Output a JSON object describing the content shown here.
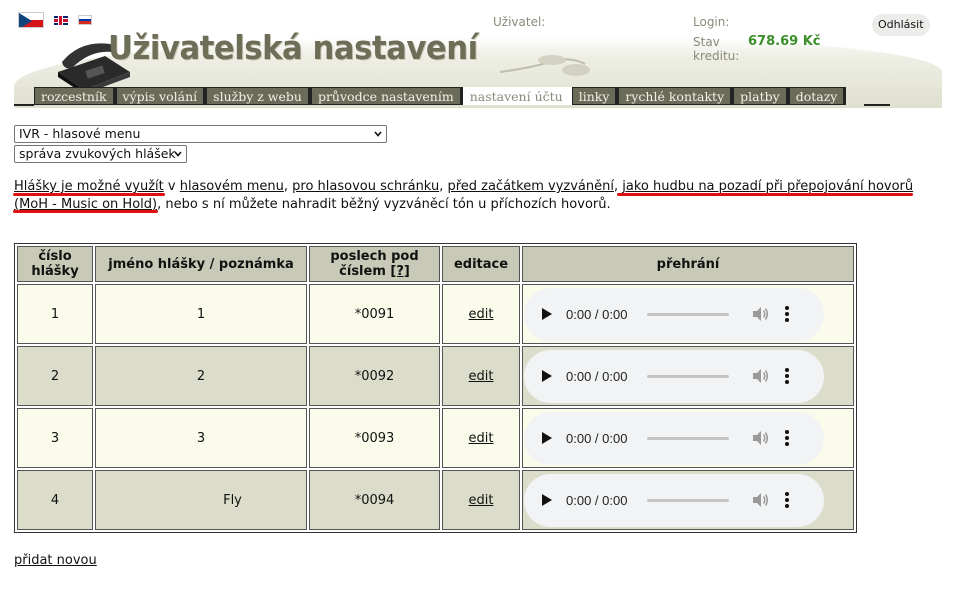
{
  "header": {
    "title": "Uživatelská nastavení",
    "user_label": "Uživatel:",
    "login_label": "Login:",
    "credit_label": "Stav kreditu:",
    "credit_value": "678.69 Kč",
    "logout_label": "Odhlásit"
  },
  "languages": [
    "cs",
    "en",
    "ru"
  ],
  "nav": [
    {
      "label": "rozcestník",
      "active": false
    },
    {
      "label": "výpis volání",
      "active": false
    },
    {
      "label": "služby z webu",
      "active": false
    },
    {
      "label": "průvodce nastavením",
      "active": false
    },
    {
      "label": "nastavení účtu",
      "active": true
    },
    {
      "label": "linky",
      "active": false
    },
    {
      "label": "rychlé kontakty",
      "active": false
    },
    {
      "label": "platby",
      "active": false
    },
    {
      "label": "dotazy",
      "active": false
    }
  ],
  "selects": {
    "ivr": "IVR - hlasové menu",
    "sound": "správa zvukových hlášek"
  },
  "info": {
    "link1": "Hlášky je možné využít",
    "t1": " v ",
    "link2": "hlasovém menu",
    "t2": ", ",
    "link3": "pro hlasovou schránku",
    "t3": ", ",
    "link4": "před začátkem vyzvánění",
    "t4": ", ",
    "link5": "jako hudbu na pozadí při přepojování hovorů",
    "t5": " ",
    "link6": "(MoH - Music on Hold)",
    "t6": ", nebo s ní můžete nahradit běžný vyzváněcí tón u příchozích hovorů."
  },
  "table": {
    "headers": {
      "number": "číslo hlášky",
      "name": "jméno hlášky / poznámka",
      "listen": "poslech pod číslem",
      "help": "[?]",
      "edit": "editace",
      "play": "přehrání"
    },
    "rows": [
      {
        "number": "1",
        "name": "1",
        "code": "*0091",
        "edit": "edit",
        "time": "0:00 / 0:00"
      },
      {
        "number": "2",
        "name": "2",
        "code": "*0092",
        "edit": "edit",
        "time": "0:00 / 0:00"
      },
      {
        "number": "3",
        "name": "3",
        "code": "*0093",
        "edit": "edit",
        "time": "0:00 / 0:00"
      },
      {
        "number": "4",
        "name": "Fly",
        "code": "*0094",
        "edit": "edit",
        "time": "0:00 / 0:00"
      }
    ]
  },
  "add_new": "přidat novou"
}
